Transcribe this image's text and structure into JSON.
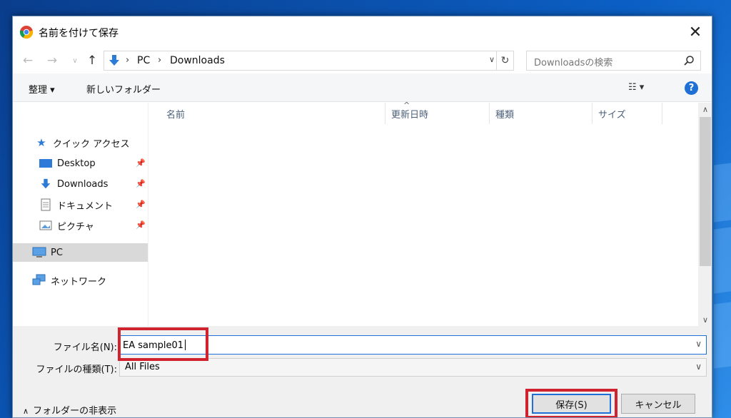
{
  "dialog": {
    "title": "名前を付けて保存",
    "close_label": "✕"
  },
  "address": {
    "crumbs": [
      "PC",
      "Downloads"
    ],
    "search_placeholder": "Downloadsの検索"
  },
  "toolbar": {
    "organize_label": "整理 ▾",
    "new_folder_label": "新しいフォルダー",
    "help_label": "?"
  },
  "sidebar": {
    "quick_access": "クイック アクセス",
    "items": [
      {
        "label": "Desktop"
      },
      {
        "label": "Downloads"
      },
      {
        "label": "ドキュメント"
      },
      {
        "label": "ピクチャ"
      }
    ],
    "pc": "PC",
    "network": "ネットワーク"
  },
  "filelist": {
    "columns": [
      "名前",
      "更新日時",
      "種類",
      "サイズ"
    ]
  },
  "form": {
    "filename_label": "ファイル名(N):",
    "filename_value": "EA sample01",
    "filetype_label": "ファイルの種類(T):",
    "filetype_value": "All Files",
    "hide_folders_label": "フォルダーの非表示",
    "save_label": "保存(S)",
    "cancel_label": "キャンセル"
  },
  "colors": {
    "accent": "#1e6fd6",
    "highlight": "#d0222f"
  }
}
